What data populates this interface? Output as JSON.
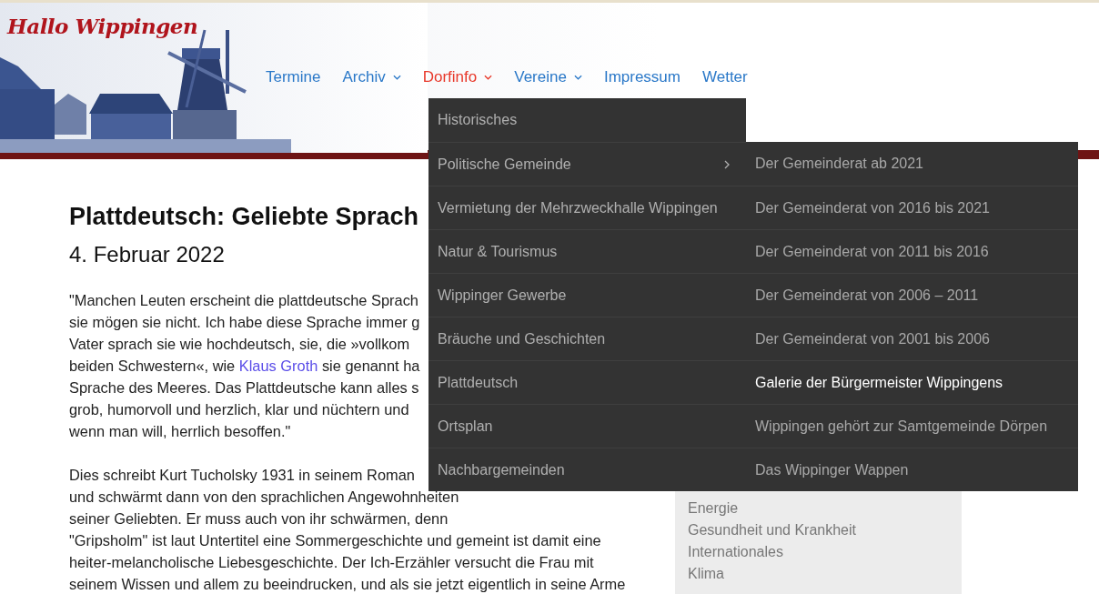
{
  "site": {
    "logo": "Hallo Wippingen"
  },
  "nav": [
    {
      "label": "Termine",
      "dropdown": false,
      "selected": false
    },
    {
      "label": "Archiv",
      "dropdown": true,
      "selected": false
    },
    {
      "label": "Dorfinfo",
      "dropdown": true,
      "selected": true
    },
    {
      "label": "Vereine",
      "dropdown": true,
      "selected": false
    },
    {
      "label": "Impressum",
      "dropdown": false,
      "selected": false
    },
    {
      "label": "Wetter",
      "dropdown": false,
      "selected": false
    }
  ],
  "dropdown": {
    "items": [
      {
        "label": "Historisches",
        "submenu": false
      },
      {
        "label": "Politische Gemeinde",
        "submenu": true
      },
      {
        "label": "Vermietung der Mehrzweckhalle Wippingen",
        "submenu": false
      },
      {
        "label": "Natur & Tourismus",
        "submenu": false
      },
      {
        "label": "Wippinger Gewerbe",
        "submenu": false
      },
      {
        "label": "Bräuche und Geschichten",
        "submenu": false
      },
      {
        "label": "Plattdeutsch",
        "submenu": false
      },
      {
        "label": "Ortsplan",
        "submenu": false
      },
      {
        "label": "Nachbargemeinden",
        "submenu": false
      }
    ],
    "submenu": [
      {
        "label": "Der Gemeinderat ab 2021",
        "selected": false
      },
      {
        "label": "Der Gemeinderat von 2016 bis 2021",
        "selected": false
      },
      {
        "label": "Der Gemeinderat von 2011 bis 2016",
        "selected": false
      },
      {
        "label": "Der Gemeinderat von 2006 – 2011",
        "selected": false
      },
      {
        "label": "Der Gemeinderat von 2001 bis 2006",
        "selected": false
      },
      {
        "label": "Galerie der Bürgermeister Wippingens",
        "selected": true
      },
      {
        "label": "Wippingen gehört zur Samtgemeinde Dörpen",
        "selected": false
      },
      {
        "label": "Das Wippinger Wappen",
        "selected": false
      }
    ]
  },
  "article": {
    "title": "Plattdeutsch: Geliebte Sprach",
    "date": "4. Februar 2022",
    "paragraphs": [
      [
        [
          {
            "text": "\"Manchen Leuten erscheint die plattdeutsche Sprach"
          }
        ],
        [
          {
            "text": "sie mögen sie nicht. Ich habe diese Sprache immer g"
          }
        ],
        [
          {
            "text": "Vater sprach sie wie hochdeutsch, sie, die »vollkom"
          }
        ],
        [
          {
            "text": "beiden Schwestern«, wie "
          },
          {
            "text": "Klaus Groth",
            "link": true
          },
          {
            "text": " sie genannt ha"
          }
        ],
        [
          {
            "text": "Sprache des Meeres. Das Plattdeutsche kann alles s"
          }
        ],
        [
          {
            "text": "grob, humorvoll und herzlich, klar und nüchtern und"
          }
        ],
        [
          {
            "text": "wenn man will, herrlich besoffen.\""
          }
        ]
      ],
      [
        [
          {
            "text": "Dies schreibt Kurt Tucholsky 1931 in seinem Roman"
          }
        ],
        [
          {
            "text": "und schwärmt dann von den sprachlichen Angewohnheiten"
          }
        ],
        [
          {
            "text": "seiner Geliebten. Er muss auch von ihr schwärmen, denn"
          }
        ],
        [
          {
            "text": "\"Gripsholm\" ist laut Untertitel eine Sommergeschichte und gemeint ist damit eine"
          }
        ],
        [
          {
            "text": "heiter-melancholische Liebesgeschichte. Der Ich-Erzähler versucht die Frau mit"
          }
        ],
        [
          {
            "text": "seinem Wissen und allem zu beeindrucken, und als sie jetzt eigentlich in seine Arme"
          }
        ]
      ]
    ]
  },
  "sidebar": {
    "items": [
      "Energie",
      "Gesundheit und Krankheit",
      "Internationales",
      "Klima"
    ]
  }
}
